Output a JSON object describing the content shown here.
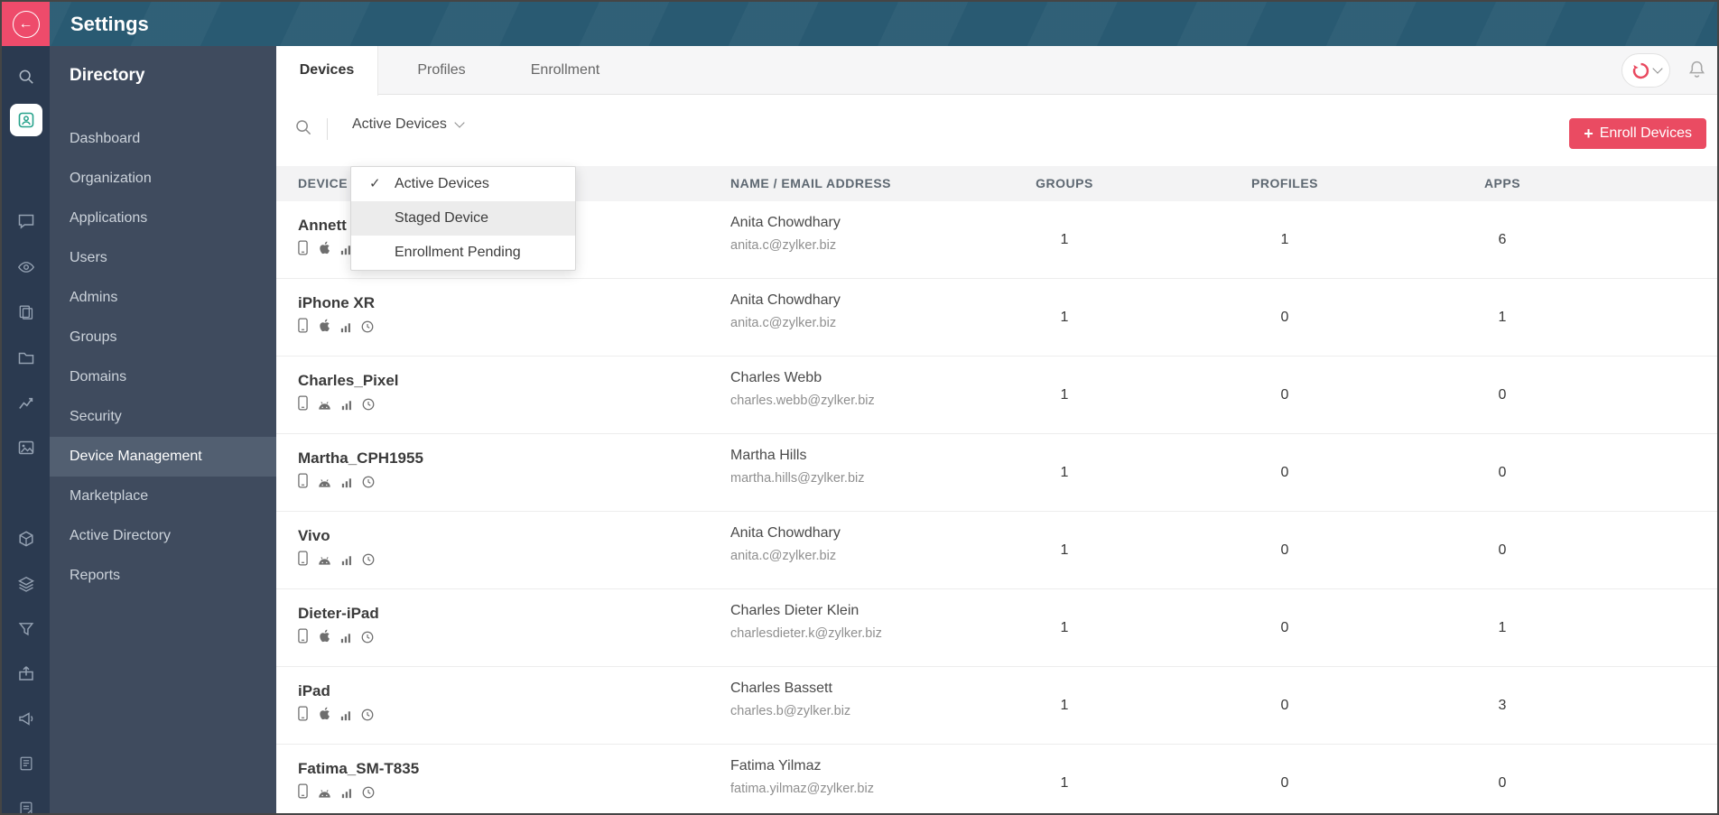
{
  "app": {
    "title": "Settings"
  },
  "colors": {
    "accent": "#ea4b62",
    "topbar": "#295a72",
    "rail": "#2b3a50",
    "sidebar": "#3f4b5e",
    "selected_item": "#525f71",
    "app_tile_glyph": "#26a28b"
  },
  "rail": {
    "icons": [
      "search-icon",
      "directory-app-icon",
      "chat-icon",
      "eye-icon",
      "pages-icon",
      "folder-icon",
      "chart-icon",
      "gallery-icon",
      "cube-icon",
      "layers-icon",
      "filter-icon",
      "package-icon",
      "megaphone-icon",
      "form-icon",
      "notes-icon"
    ]
  },
  "sidebar": {
    "title": "Directory",
    "items": [
      {
        "label": "Dashboard",
        "active": false
      },
      {
        "label": "Organization",
        "active": false
      },
      {
        "label": "Applications",
        "active": false
      },
      {
        "label": "Users",
        "active": false
      },
      {
        "label": "Admins",
        "active": false
      },
      {
        "label": "Groups",
        "active": false
      },
      {
        "label": "Domains",
        "active": false
      },
      {
        "label": "Security",
        "active": false
      },
      {
        "label": "Device Management",
        "active": true
      },
      {
        "label": "Marketplace",
        "active": false
      },
      {
        "label": "Active Directory",
        "active": false
      },
      {
        "label": "Reports",
        "active": false
      }
    ]
  },
  "header": {
    "tabs": [
      {
        "label": "Devices",
        "active": true
      },
      {
        "label": "Profiles",
        "active": false
      },
      {
        "label": "Enrollment",
        "active": false
      }
    ],
    "icons": [
      "account-logo-icon",
      "chevron-down-icon",
      "bell-icon"
    ]
  },
  "toolbar": {
    "filter_value": "Active Devices",
    "enroll_plus": "+",
    "enroll_label": "Enroll Devices"
  },
  "filter_dropdown": {
    "items": [
      {
        "label": "Active Devices",
        "checked": true,
        "highlighted": false
      },
      {
        "label": "Staged Device",
        "checked": false,
        "highlighted": true
      },
      {
        "label": "Enrollment Pending",
        "checked": false,
        "highlighted": false
      }
    ],
    "check_glyph": "✓"
  },
  "table": {
    "headers": [
      "DEVICE",
      "NAME / EMAIL ADDRESS",
      "GROUPS",
      "PROFILES",
      "APPS"
    ],
    "rows": [
      {
        "device": "Annett",
        "icons": [
          "phone",
          "apple",
          "signal",
          "clock"
        ],
        "name": "Anita Chowdhary",
        "email": "anita.c@zylker.biz",
        "groups": "1",
        "profiles": "1",
        "apps": "6"
      },
      {
        "device": "iPhone XR",
        "icons": [
          "phone",
          "apple",
          "signal",
          "clock"
        ],
        "name": "Anita Chowdhary",
        "email": "anita.c@zylker.biz",
        "groups": "1",
        "profiles": "0",
        "apps": "1"
      },
      {
        "device": "Charles_Pixel",
        "icons": [
          "phone",
          "android",
          "signal",
          "clock"
        ],
        "name": "Charles Webb",
        "email": "charles.webb@zylker.biz",
        "groups": "1",
        "profiles": "0",
        "apps": "0"
      },
      {
        "device": "Martha_CPH1955",
        "icons": [
          "phone",
          "android",
          "signal",
          "clock"
        ],
        "name": "Martha Hills",
        "email": "martha.hills@zylker.biz",
        "groups": "1",
        "profiles": "0",
        "apps": "0"
      },
      {
        "device": "Vivo",
        "icons": [
          "phone",
          "android",
          "signal",
          "clock"
        ],
        "name": "Anita Chowdhary",
        "email": "anita.c@zylker.biz",
        "groups": "1",
        "profiles": "0",
        "apps": "0"
      },
      {
        "device": "Dieter-iPad",
        "icons": [
          "phone",
          "apple",
          "signal",
          "clock"
        ],
        "name": "Charles Dieter Klein",
        "email": "charlesdieter.k@zylker.biz",
        "groups": "1",
        "profiles": "0",
        "apps": "1"
      },
      {
        "device": "iPad",
        "icons": [
          "phone",
          "apple",
          "signal",
          "clock"
        ],
        "name": "Charles Bassett",
        "email": "charles.b@zylker.biz",
        "groups": "1",
        "profiles": "0",
        "apps": "3"
      },
      {
        "device": "Fatima_SM-T835",
        "icons": [
          "phone",
          "android",
          "signal",
          "clock"
        ],
        "name": "Fatima Yilmaz",
        "email": "fatima.yilmaz@zylker.biz",
        "groups": "1",
        "profiles": "0",
        "apps": "0"
      }
    ]
  }
}
